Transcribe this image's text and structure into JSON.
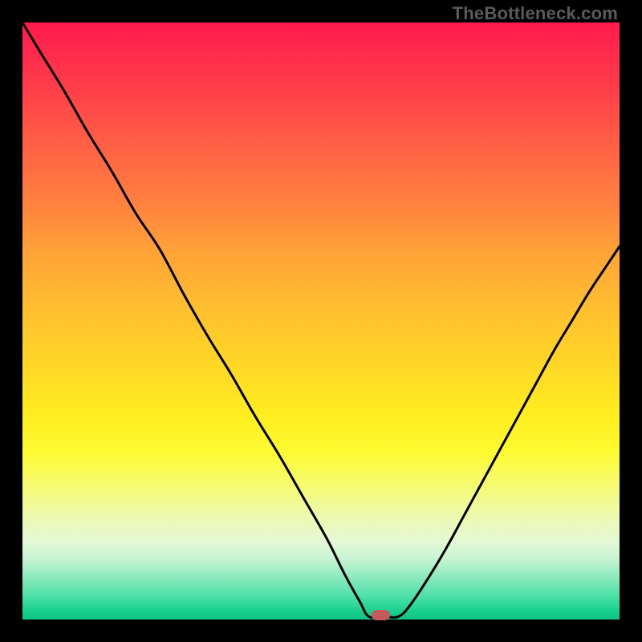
{
  "watermark": "TheBottleneck.com",
  "chart_data": {
    "type": "line",
    "title": "",
    "xlabel": "",
    "ylabel": "",
    "xlim": [
      0,
      100
    ],
    "ylim": [
      0,
      100
    ],
    "grid": false,
    "legend": false,
    "background": {
      "type": "vertical-gradient",
      "stops": [
        {
          "pos": 0.0,
          "color": "#ff1a4d"
        },
        {
          "pos": 0.1,
          "color": "#ff3a4a"
        },
        {
          "pos": 0.2,
          "color": "#ff5e45"
        },
        {
          "pos": 0.3,
          "color": "#ff803f"
        },
        {
          "pos": 0.38,
          "color": "#ffa138"
        },
        {
          "pos": 0.48,
          "color": "#ffbf2f"
        },
        {
          "pos": 0.58,
          "color": "#ffd926"
        },
        {
          "pos": 0.66,
          "color": "#ffee20"
        },
        {
          "pos": 0.72,
          "color": "#fdfb32"
        },
        {
          "pos": 0.78,
          "color": "#f6fb77"
        },
        {
          "pos": 0.83,
          "color": "#edf9b2"
        },
        {
          "pos": 0.87,
          "color": "#e4f8d6"
        },
        {
          "pos": 0.9,
          "color": "#c5f3d2"
        },
        {
          "pos": 0.93,
          "color": "#8beabd"
        },
        {
          "pos": 0.96,
          "color": "#4fe0a9"
        },
        {
          "pos": 0.985,
          "color": "#1bd18f"
        },
        {
          "pos": 1.0,
          "color": "#0ec484"
        }
      ]
    },
    "series": [
      {
        "name": "bottleneck-curve",
        "color": "#000000",
        "stroke_width": 3,
        "x": [
          0.0,
          3.0,
          7.0,
          11.0,
          15.0,
          19.0,
          23.0,
          27.0,
          31.0,
          35.0,
          39.0,
          43.0,
          47.0,
          51.0,
          54.0,
          56.5,
          58.0,
          60.5,
          63.0,
          65.0,
          68.0,
          71.0,
          74.0,
          77.0,
          80.0,
          83.0,
          86.0,
          89.0,
          92.0,
          95.0,
          98.0,
          100.0
        ],
        "y": [
          100.0,
          95.0,
          88.5,
          81.5,
          75.0,
          68.0,
          62.0,
          54.5,
          47.5,
          41.0,
          34.0,
          27.5,
          20.5,
          13.5,
          7.5,
          3.0,
          0.5,
          0.5,
          0.5,
          2.5,
          7.0,
          12.0,
          17.5,
          23.0,
          28.5,
          34.0,
          39.5,
          45.0,
          50.0,
          55.0,
          59.5,
          62.5
        ]
      }
    ],
    "markers": [
      {
        "name": "optimal-point",
        "shape": "rounded-rect",
        "color": "#c45a5d",
        "x": 60.0,
        "y": 0.7,
        "width_frac": 0.03,
        "height_frac": 0.017
      }
    ]
  }
}
